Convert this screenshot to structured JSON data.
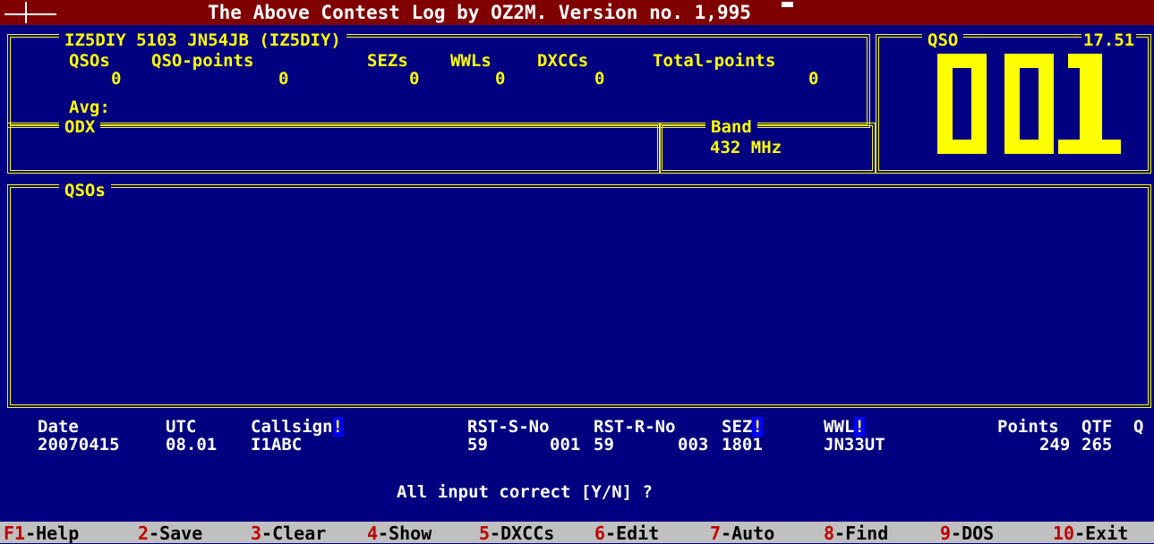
{
  "title": "The Above Contest Log by OZ2M. Version no. 1,995",
  "station": {
    "header": "IZ5DIY 5103 JN54JB (IZ5DIY)",
    "stats": {
      "qsos_label": "QSOs",
      "qsos_value": "0",
      "qso_points_label": "QSO-points",
      "qso_points_value": "0",
      "sezs_label": "SEZs",
      "sezs_value": "0",
      "wwls_label": "WWLs",
      "wwls_value": "0",
      "dxccs_label": "DXCCs",
      "dxccs_value": "0",
      "total_points_label": "Total-points",
      "total_points_value": "0"
    },
    "avg_label": "Avg:",
    "odx_label": "ODX"
  },
  "band": {
    "label": "Band",
    "value": "432 MHz"
  },
  "qso_panel": {
    "label": "QSO",
    "time": "17.51",
    "counter": "001"
  },
  "qsos_list": {
    "label": "QSOs"
  },
  "entry": {
    "headers": {
      "date": "Date",
      "utc": "UTC",
      "callsign": "Callsign",
      "rst_s_no": "RST-S-No",
      "rst_r_no": "RST-R-No",
      "sez": "SEZ",
      "wwl": "WWL",
      "points": "Points",
      "qtf": "QTF",
      "q": "Q",
      "required_mark": "!"
    },
    "values": {
      "date": "20070415",
      "utc": "08.01",
      "callsign": "I1ABC",
      "rst_s": "59",
      "no_s": "001",
      "rst_r": "59",
      "no_r": "003",
      "sez": "1801",
      "wwl": "JN33UT",
      "points": "249",
      "qtf": "265"
    },
    "prompt": "All input correct [Y/N] ?"
  },
  "fkeys": [
    {
      "num": "F1",
      "label": "-Help"
    },
    {
      "num": "2",
      "label": "-Save"
    },
    {
      "num": "3",
      "label": "-Clear"
    },
    {
      "num": "4",
      "label": "-Show"
    },
    {
      "num": "5",
      "label": "-DXCCs"
    },
    {
      "num": "6",
      "label": "-Edit"
    },
    {
      "num": "7",
      "label": "-Auto"
    },
    {
      "num": "8",
      "label": "-Find"
    },
    {
      "num": "9",
      "label": "-DOS"
    },
    {
      "num": "10",
      "label": "-Exit"
    }
  ],
  "colors": {
    "background": "#000080",
    "frame": "#FFFF00",
    "title_bar": "#800000",
    "fkey_bar": "#C0C0C0",
    "fkey_number": "#C00000"
  }
}
